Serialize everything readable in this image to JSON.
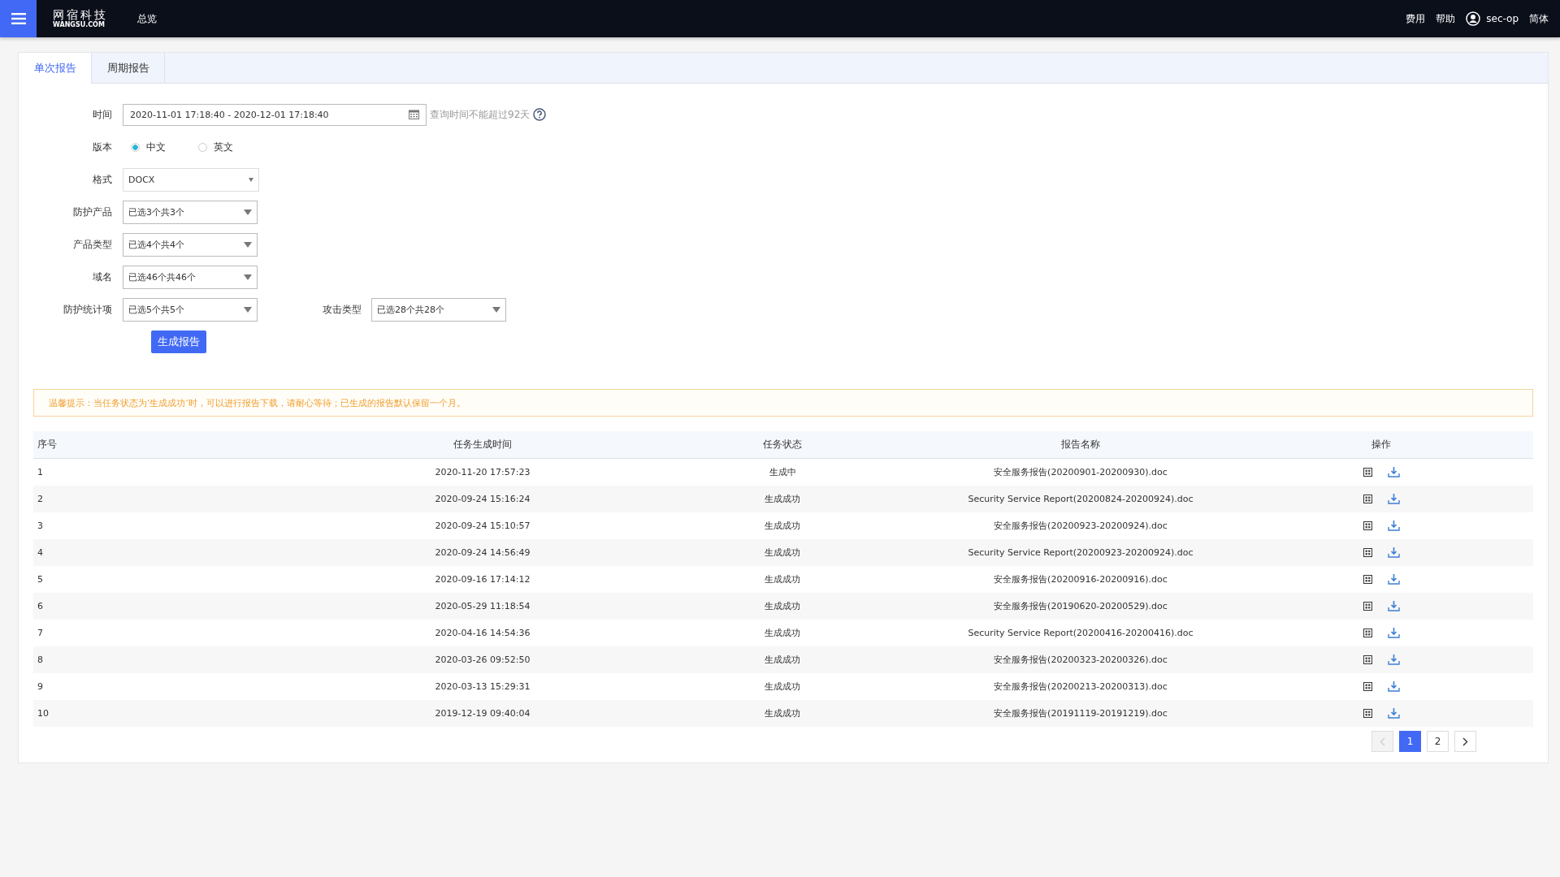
{
  "header": {
    "logo_cn": "网宿科技",
    "logo_en": "WANGSU.COM",
    "nav": [
      "总览"
    ],
    "links": [
      "费用",
      "帮助"
    ],
    "user": "sec-op",
    "language": "简体"
  },
  "tabs": [
    {
      "label": "单次报告",
      "selected": true
    },
    {
      "label": "周期报告",
      "selected": false
    }
  ],
  "form": {
    "time": {
      "label": "时间",
      "value": "2020-11-01 17:18:40 - 2020-12-01 17:18:40",
      "hint": "查询时间不能超过92天"
    },
    "version": {
      "label": "版本",
      "options": [
        {
          "label": "中文",
          "selected": true
        },
        {
          "label": "英文",
          "selected": false
        }
      ]
    },
    "format": {
      "label": "格式",
      "value": "DOCX"
    },
    "select_rows": [
      {
        "items": [
          {
            "label": "防护产品",
            "value": "已选3个共3个"
          }
        ]
      },
      {
        "items": [
          {
            "label": "产品类型",
            "value": "已选4个共4个"
          }
        ]
      },
      {
        "items": [
          {
            "label": "域名",
            "value": "已选46个共46个"
          }
        ]
      },
      {
        "items": [
          {
            "label": "防护统计项",
            "value": "已选5个共5个"
          },
          {
            "label": "攻击类型",
            "value": "已选28个共28个"
          }
        ]
      }
    ],
    "submit": "生成报告"
  },
  "notice": "温馨提示：当任务状态为‘生成成功’时，可以进行报告下载，请耐心等待；已生成的报告默认保留一个月。",
  "table": {
    "columns": [
      "序号",
      "任务生成时间",
      "任务状态",
      "报告名称",
      "操作"
    ],
    "rows": [
      {
        "index": "1",
        "time": "2020-11-20 17:57:23",
        "status": "生成中",
        "name": "安全服务报告(20200901-20200930).doc"
      },
      {
        "index": "2",
        "time": "2020-09-24 15:16:24",
        "status": "生成成功",
        "name": "Security Service Report(20200824-20200924).doc"
      },
      {
        "index": "3",
        "time": "2020-09-24 15:10:57",
        "status": "生成成功",
        "name": "安全服务报告(20200923-20200924).doc"
      },
      {
        "index": "4",
        "time": "2020-09-24 14:56:49",
        "status": "生成成功",
        "name": "Security Service Report(20200923-20200924).doc"
      },
      {
        "index": "5",
        "time": "2020-09-16 17:14:12",
        "status": "生成成功",
        "name": "安全服务报告(20200916-20200916).doc"
      },
      {
        "index": "6",
        "time": "2020-05-29 11:18:54",
        "status": "生成成功",
        "name": "安全服务报告(20190620-20200529).doc"
      },
      {
        "index": "7",
        "time": "2020-04-16 14:54:36",
        "status": "生成成功",
        "name": "Security Service Report(20200416-20200416).doc"
      },
      {
        "index": "8",
        "time": "2020-03-26 09:52:50",
        "status": "生成成功",
        "name": "安全服务报告(20200323-20200326).doc"
      },
      {
        "index": "9",
        "time": "2020-03-13 15:29:31",
        "status": "生成成功",
        "name": "安全服务报告(20200213-20200313).doc"
      },
      {
        "index": "10",
        "time": "2019-12-19 09:40:04",
        "status": "生成成功",
        "name": "安全服务报告(20191119-20191219).doc"
      }
    ]
  },
  "pagination": {
    "prev_disabled": true,
    "pages": [
      {
        "label": "1",
        "selected": true
      },
      {
        "label": "2",
        "selected": false
      }
    ]
  }
}
